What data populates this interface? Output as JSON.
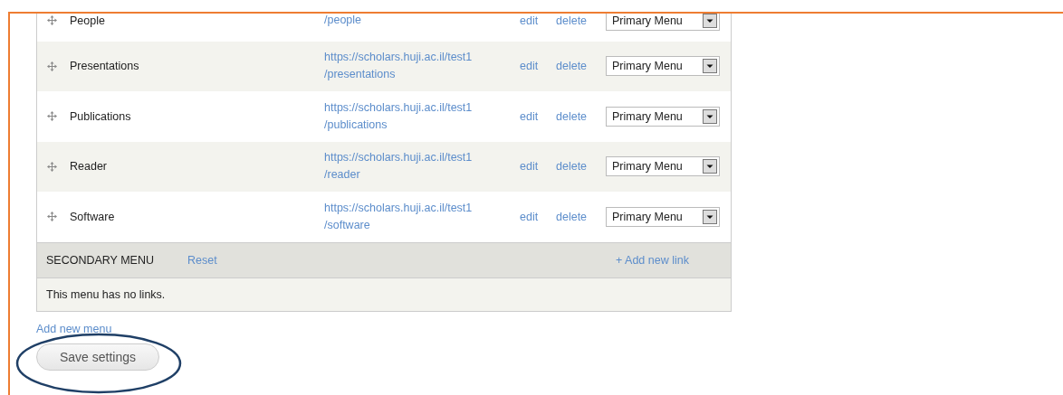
{
  "primary_links": [
    {
      "title": "People",
      "url_lines": [
        "/people"
      ],
      "edit": "edit",
      "delete": "delete",
      "menu": "Primary Menu"
    },
    {
      "title": "Presentations",
      "url_lines": [
        "https://scholars.huji.ac.il/test1",
        "/presentations"
      ],
      "edit": "edit",
      "delete": "delete",
      "menu": "Primary Menu"
    },
    {
      "title": "Publications",
      "url_lines": [
        "https://scholars.huji.ac.il/test1",
        "/publications"
      ],
      "edit": "edit",
      "delete": "delete",
      "menu": "Primary Menu"
    },
    {
      "title": "Reader",
      "url_lines": [
        "https://scholars.huji.ac.il/test1",
        "/reader"
      ],
      "edit": "edit",
      "delete": "delete",
      "menu": "Primary Menu"
    },
    {
      "title": "Software",
      "url_lines": [
        "https://scholars.huji.ac.il/test1",
        "/software"
      ],
      "edit": "edit",
      "delete": "delete",
      "menu": "Primary Menu"
    }
  ],
  "secondary_menu": {
    "title": "SECONDARY MENU",
    "reset": "Reset",
    "add_link": "+ Add new link",
    "empty_message": "This menu has no links."
  },
  "add_menu": "Add new menu",
  "save_button": "Save settings"
}
